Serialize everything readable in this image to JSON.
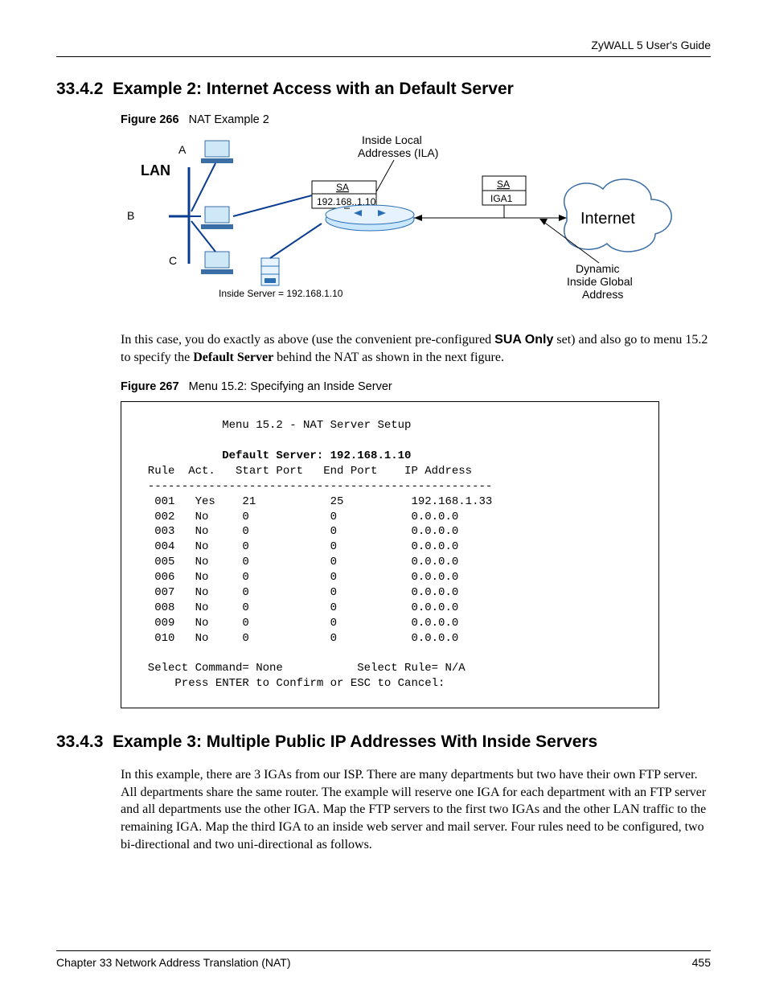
{
  "running_head": "ZyWALL 5 User's Guide",
  "section1": {
    "number": "33.4.2",
    "title": "Example 2: Internet Access with an Default Server"
  },
  "figure266": {
    "label": "Figure 266",
    "caption": "NAT Example 2",
    "labels": {
      "lan": "LAN",
      "a": "A",
      "b": "B",
      "c": "C",
      "ila_top": "Inside Local",
      "ila_bot": "Addresses (ILA)",
      "sa1": "SA",
      "boxip": "192.168..1.10",
      "inside_server": "Inside Server = 192.168.1.10",
      "sa2": "SA",
      "iga1": "IGA1",
      "internet": "Internet",
      "dyn1": "Dynamic",
      "dyn2": "Inside Global",
      "dyn3": "Address"
    }
  },
  "para1": {
    "pre": "In this case, you do exactly as above (use the convenient pre-configured ",
    "bold1": "SUA Only",
    "mid": " set) and also go to menu 15.2 to specify the ",
    "bold2": "Default Server",
    "post": " behind the NAT as shown in the next figure."
  },
  "figure267": {
    "label": "Figure 267",
    "caption": "Menu 15.2: Specifying an Inside Server"
  },
  "terminal": {
    "title": "Menu 15.2 - NAT Server Setup",
    "default_server": "Default Server: 192.168.1.10",
    "header": "  Rule  Act.   Start Port   End Port    IP Address",
    "divider": "  ---------------------------------------------------",
    "rows": [
      "   001   Yes    21           25          192.168.1.33",
      "   002   No     0            0           0.0.0.0",
      "   003   No     0            0           0.0.0.0",
      "   004   No     0            0           0.0.0.0",
      "   005   No     0            0           0.0.0.0",
      "   006   No     0            0           0.0.0.0",
      "   007   No     0            0           0.0.0.0",
      "   008   No     0            0           0.0.0.0",
      "   009   No     0            0           0.0.0.0",
      "   010   No     0            0           0.0.0.0"
    ],
    "select_line": "  Select Command= None           Select Rule= N/A",
    "press_line": "      Press ENTER to Confirm or ESC to Cancel:"
  },
  "section2": {
    "number": "33.4.3",
    "title": "Example 3: Multiple Public IP Addresses With Inside Servers"
  },
  "para2": "In this example, there are 3 IGAs from our ISP. There are many departments but two have their own FTP server. All departments share the same router. The example will reserve one IGA for each department with an FTP server and all departments use the other IGA. Map the FTP servers to the first two IGAs and the other LAN traffic to the remaining IGA. Map the third IGA to an inside web server and mail server. Four rules need to be configured, two bi-directional and two uni-directional as follows.",
  "footer": {
    "left": "Chapter 33 Network Address Translation (NAT)",
    "right": "455"
  }
}
